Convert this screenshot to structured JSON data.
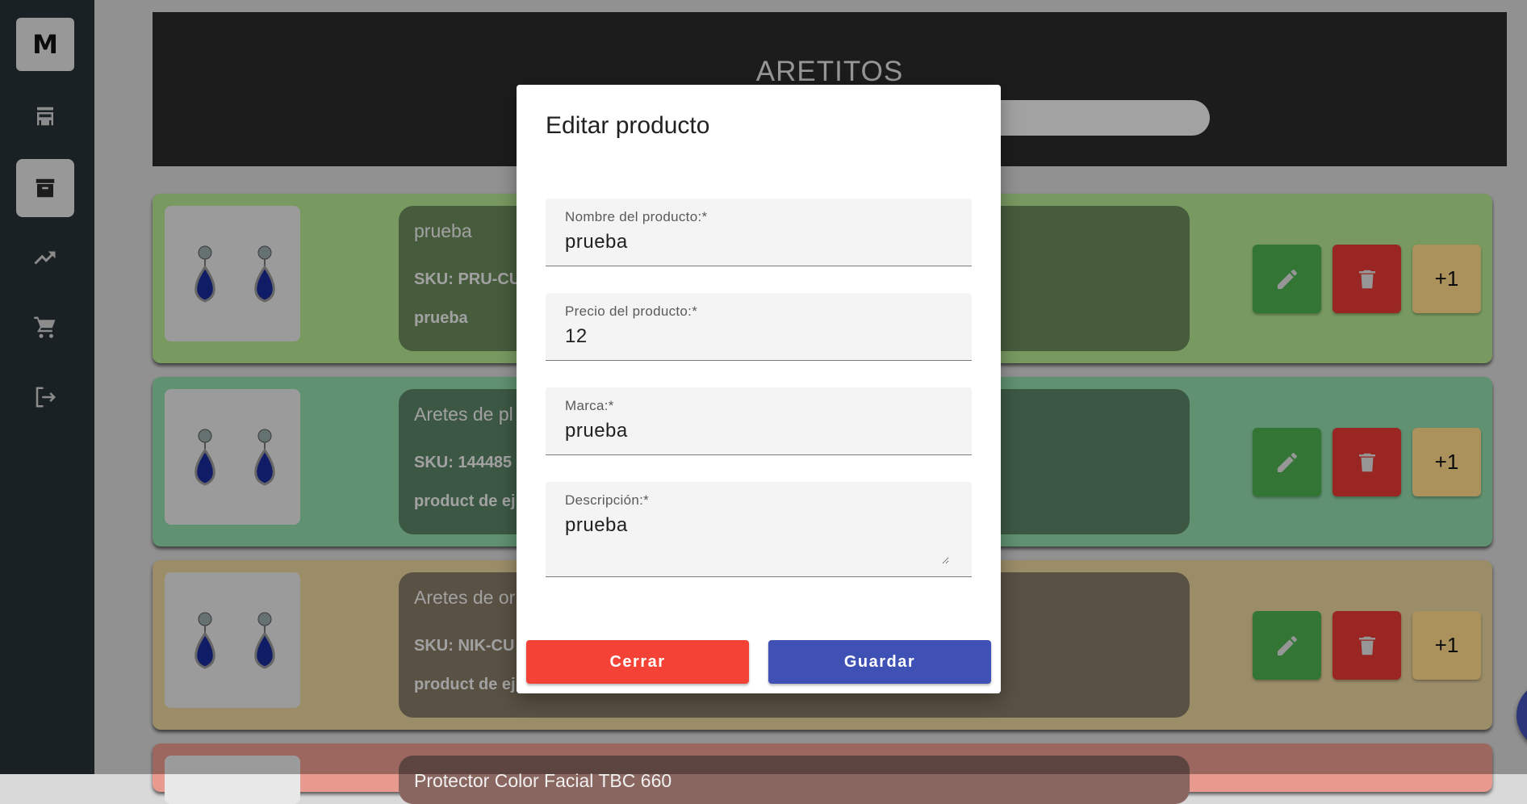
{
  "sidebar": {
    "logo": "M",
    "items": [
      {
        "icon": "store-icon"
      },
      {
        "icon": "archive-icon",
        "active": true
      },
      {
        "icon": "trending-up-icon"
      },
      {
        "icon": "cart-icon"
      },
      {
        "icon": "logout-icon"
      }
    ]
  },
  "header": {
    "title": "ARETITOS"
  },
  "products": [
    {
      "name": "prueba",
      "sku": "SKU: PRU-CU",
      "desc": "prueba",
      "card_color": "#b3e58f",
      "info_color": "#6b8a5c"
    },
    {
      "name": "Aretes de pl",
      "sku": "SKU: 144485",
      "desc": "product de ej",
      "card_color": "#8fd9a8",
      "info_color": "#5a8466"
    },
    {
      "name": "Aretes de or",
      "sku": "SKU: NIK-CU",
      "desc": "product de ej",
      "card_color": "#e8d39c",
      "info_color": "#857a64"
    },
    {
      "name": "Protector Color Facial TBC 660",
      "sku": "",
      "desc": "",
      "card_color": "#e89a8e",
      "info_color": "#8a6660"
    }
  ],
  "actions": {
    "plus_label": "+1",
    "edit_icon": "pencil-icon",
    "delete_icon": "trash-icon"
  },
  "fab": {
    "icon": "plus-icon",
    "color": "#3f51b5"
  },
  "modal": {
    "title": "Editar producto",
    "fields": {
      "name": {
        "label": "Nombre del producto:*",
        "value": "prueba"
      },
      "price": {
        "label": "Precio del producto:*",
        "value": "12"
      },
      "brand": {
        "label": "Marca:*",
        "value": "prueba"
      },
      "description": {
        "label": "Descripción:*",
        "value": "prueba"
      }
    },
    "close_label": "Cerrar",
    "save_label": "Guardar"
  }
}
